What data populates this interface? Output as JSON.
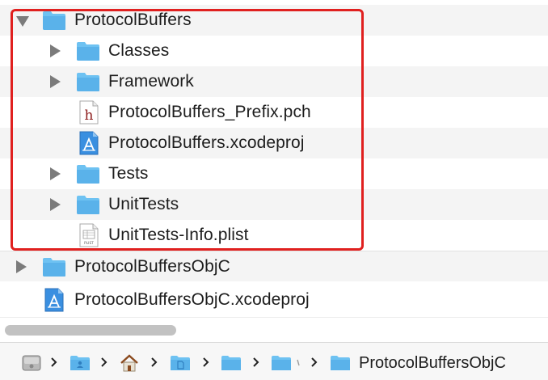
{
  "file_list": {
    "rows": [
      {
        "label": "ProtocolBuffers",
        "kind": "folder",
        "disclosure": "expanded"
      },
      {
        "label": "Classes",
        "kind": "folder",
        "disclosure": "collapsed"
      },
      {
        "label": "Framework",
        "kind": "folder",
        "disclosure": "collapsed"
      },
      {
        "label": "ProtocolBuffers_Prefix.pch",
        "kind": "header-file",
        "icon_glyph": "h"
      },
      {
        "label": "ProtocolBuffers.xcodeproj",
        "kind": "xcodeproj"
      },
      {
        "label": "Tests",
        "kind": "folder",
        "disclosure": "collapsed"
      },
      {
        "label": "UnitTests",
        "kind": "folder",
        "disclosure": "collapsed"
      },
      {
        "label": "UnitTests-Info.plist",
        "kind": "plist-file",
        "icon_glyph": "PLIST"
      },
      {
        "label": "ProtocolBuffersObjC",
        "kind": "folder",
        "disclosure": "collapsed"
      },
      {
        "label": "ProtocolBuffersObjC.xcodeproj",
        "kind": "xcodeproj"
      }
    ]
  },
  "path_bar": {
    "items": [
      "hard-drive-icon",
      "user-folder-icon",
      "home-icon",
      "documents-folder-icon",
      "folder-icon",
      "folder-icon"
    ],
    "current": "ProtocolBuffersObjC"
  },
  "colors": {
    "highlight_border": "#e0201f",
    "folder_blue": "#5ab2ea",
    "stripe": "#f4f4f4"
  }
}
